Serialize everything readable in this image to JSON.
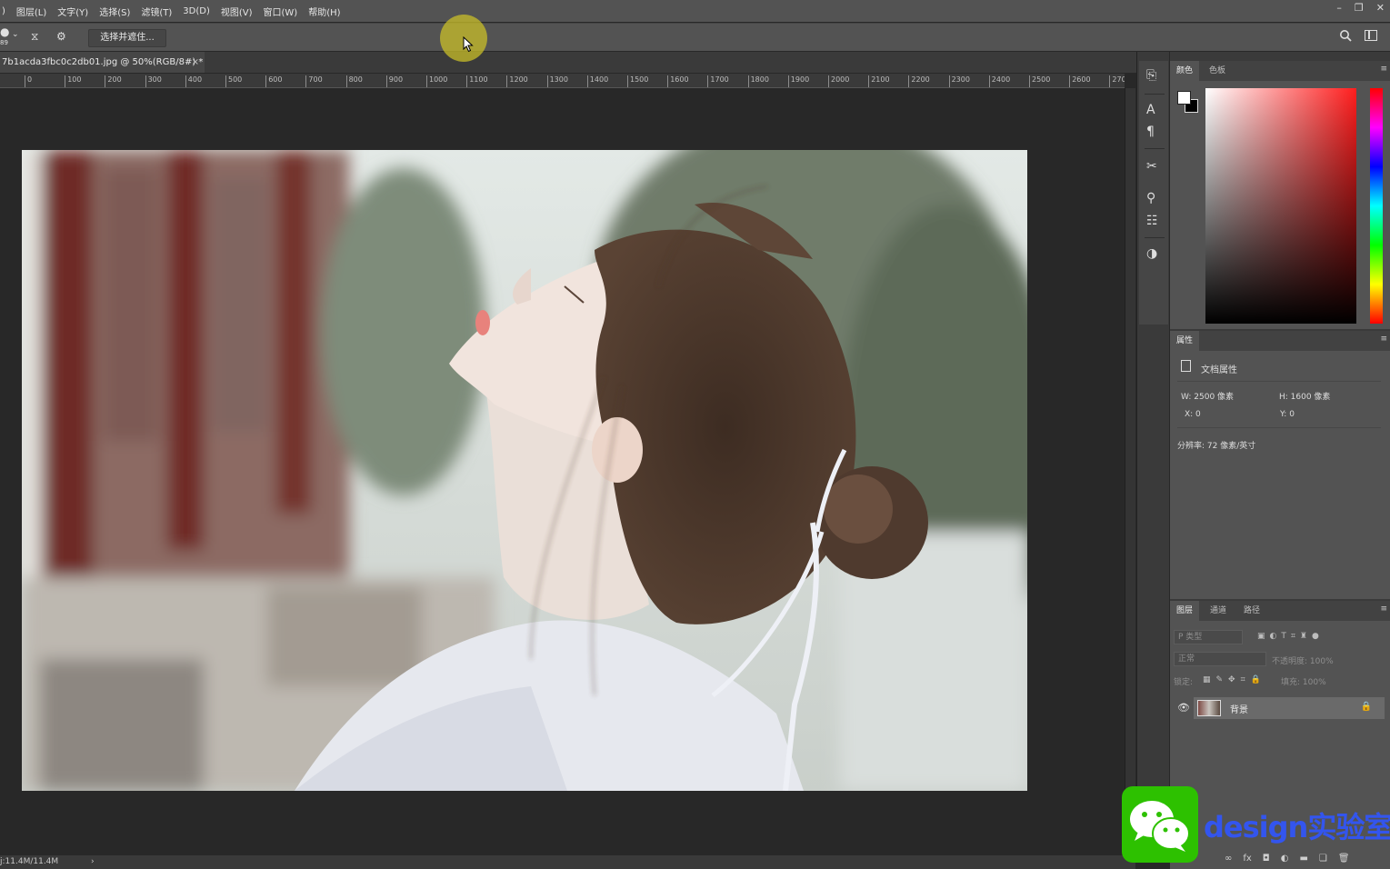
{
  "menu": [
    "图层(L)",
    "文字(Y)",
    "选择(S)",
    "滤镜(T)",
    "3D(D)",
    "视图(V)",
    "窗口(W)",
    "帮助(H)"
  ],
  "options": {
    "brush_size": "89",
    "select_mask": "选择并遮住..."
  },
  "document": {
    "tab_title": "7b1acda3fbc0c2db01.jpg @ 50%(RGB/8#) *",
    "close": "×"
  },
  "ruler": [
    "0",
    "100",
    "200",
    "300",
    "400",
    "500",
    "600",
    "700",
    "800",
    "900",
    "1000",
    "1100",
    "1200",
    "1300",
    "1400",
    "1500",
    "1600",
    "1700",
    "1800",
    "1900",
    "2000",
    "2100",
    "2200",
    "2300",
    "2400",
    "2500",
    "2600",
    "270"
  ],
  "status": {
    "doc_size": "j:11.4M/11.4M",
    "arrow": "›"
  },
  "panels": {
    "color": {
      "tabs": [
        "颜色",
        "色板"
      ]
    },
    "properties": {
      "tab": "属性",
      "doc_props": "文档属性",
      "w": "W:  2500 像素",
      "h": "H:  1600 像素",
      "x": "X:  0",
      "y": "Y:  0",
      "resolution": "分辨率: 72 像素/英寸"
    },
    "layers": {
      "tabs": [
        "图层",
        "通道",
        "路径"
      ],
      "filter": "P 类型",
      "blend": "正常",
      "opacity": "不透明度: 100%",
      "lock": "锁定:",
      "fill": "填充: 100%",
      "layer_name": "背景"
    }
  },
  "watermark": {
    "text": "design实验室"
  },
  "colors": {
    "accent": "#2dc100",
    "watermark_text": "#3355ee"
  }
}
